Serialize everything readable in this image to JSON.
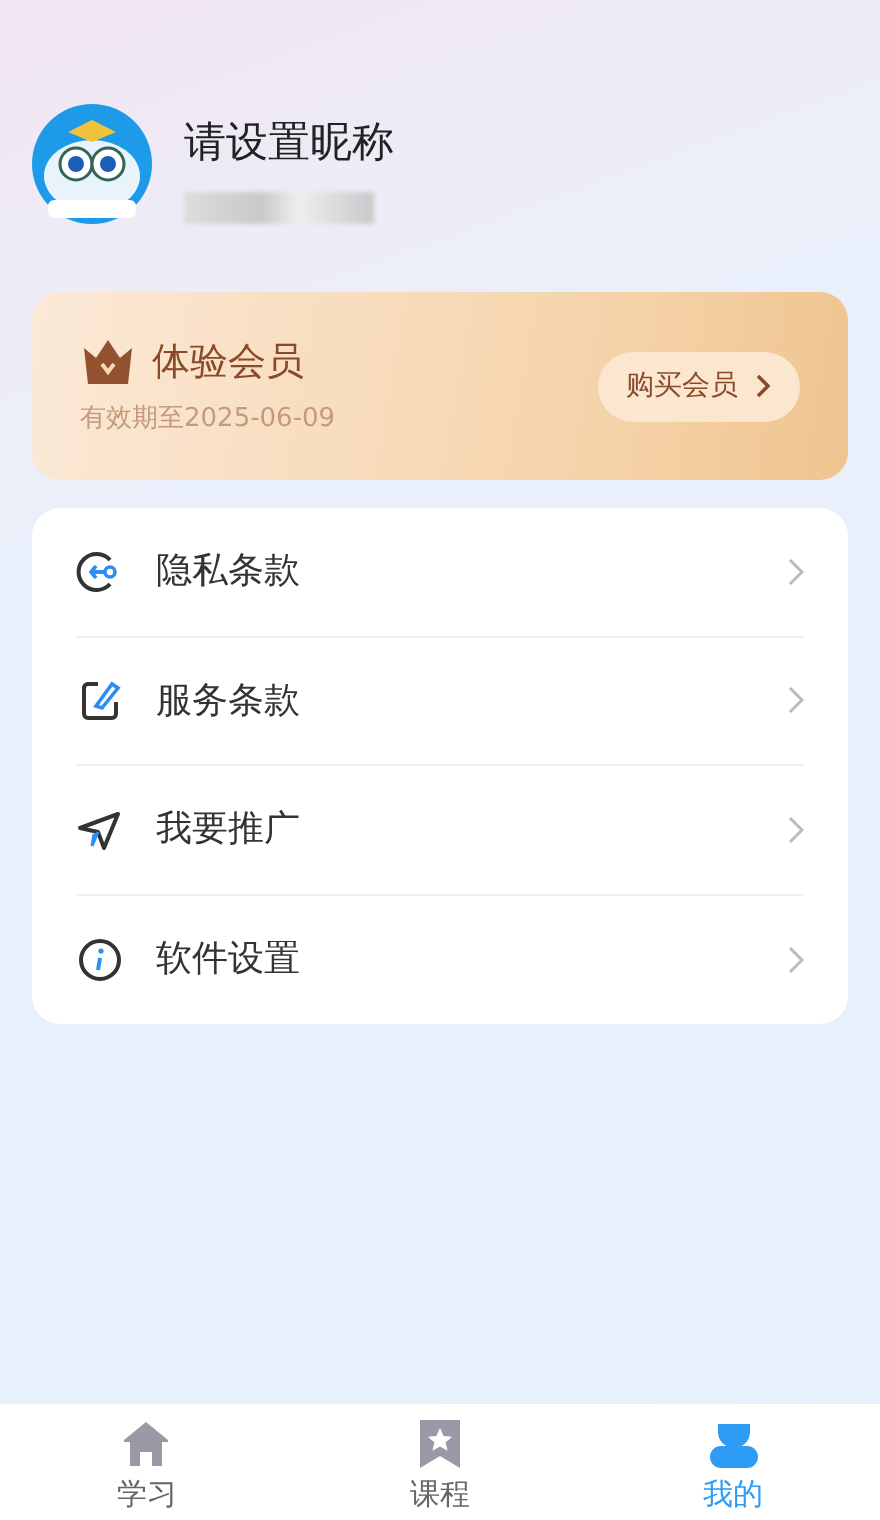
{
  "profile": {
    "nickname": "请设置昵称"
  },
  "membership": {
    "title": "体验会员",
    "expiry": "有效期至2025-06-09",
    "button": "购买会员"
  },
  "menu": [
    {
      "kind": "privacy",
      "label": "隐私条款"
    },
    {
      "kind": "terms",
      "label": "服务条款"
    },
    {
      "kind": "share",
      "label": "我要推广"
    },
    {
      "kind": "info",
      "label": "软件设置"
    }
  ],
  "tabs": [
    {
      "kind": "home",
      "label": "学习",
      "selected": false
    },
    {
      "kind": "bookmark",
      "label": "课程",
      "selected": false
    },
    {
      "kind": "person",
      "label": "我的",
      "selected": true
    }
  ]
}
